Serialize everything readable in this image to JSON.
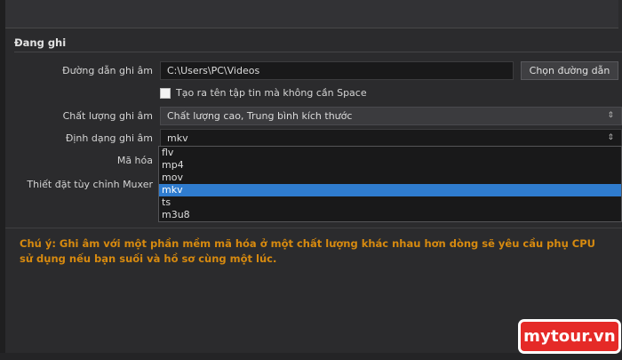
{
  "section": {
    "title": "Đang ghi"
  },
  "recording_path": {
    "label": "Đường dẫn ghi âm",
    "value": "C:\\Users\\PC\\Videos",
    "browse_button": "Chọn đường dẫn"
  },
  "no_space_option": {
    "label": "Tạo ra tên tập tin mà không cần Space",
    "checked": false
  },
  "recording_quality": {
    "label": "Chất lượng ghi âm",
    "value": "Chất lượng cao, Trung bình kích thước"
  },
  "recording_format": {
    "label": "Định dạng ghi âm",
    "value": "mkv",
    "options": [
      "flv",
      "mp4",
      "mov",
      "mkv",
      "ts",
      "m3u8"
    ],
    "selected_index": 3
  },
  "encoder": {
    "label": "Mã hóa"
  },
  "muxer": {
    "label": "Thiết đặt tùy chỉnh Muxer"
  },
  "warning": {
    "text": "Chú ý: Ghi âm với một phần mềm mã hóa ở một chất lượng khác nhau hơn dòng sẽ yêu cầu phụ CPU sử dụng nếu bạn suối và hồ sơ cùng một lúc."
  },
  "watermark": {
    "text": "mytour.vn"
  },
  "colors": {
    "background": "#2b2b2d",
    "warning": "#d78a0f",
    "selection": "#2f7ccf",
    "watermark": "#e52a27"
  }
}
